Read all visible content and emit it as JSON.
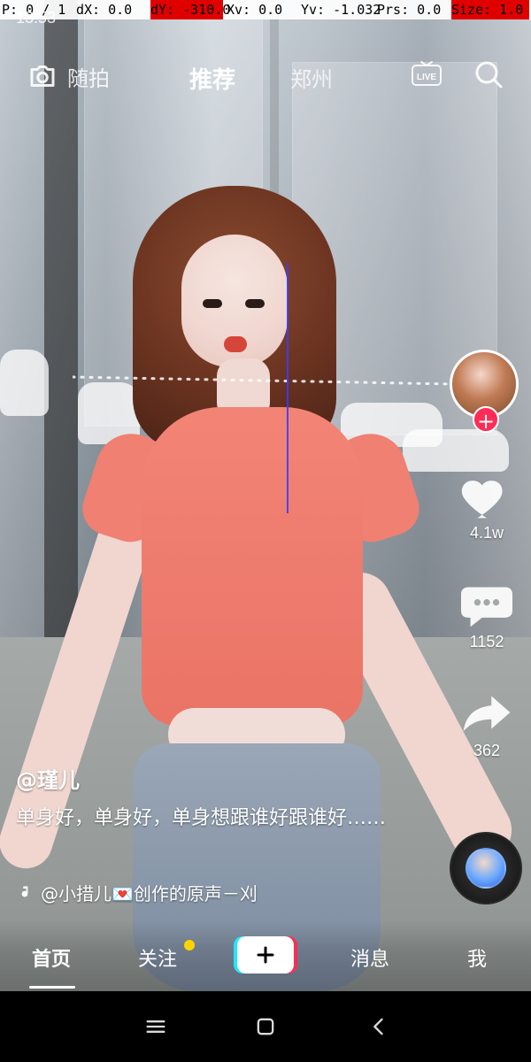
{
  "debug": {
    "p": "P: 0 / 1",
    "dx": "dX: 0.0",
    "dy": "dY: -310.0",
    "xv": "Xv: 0.0",
    "yv": "Yv: -1.032",
    "prs": "Prs: 0.0",
    "size": "Size: 1.0"
  },
  "status": {
    "time": "13:53"
  },
  "top_nav": {
    "left_label": "随拍",
    "center_label": "推荐",
    "right_label": "郑州"
  },
  "right_rail": {
    "likes": "4.1w",
    "comments": "1152",
    "shares": "362"
  },
  "caption": {
    "author": "@瑾儿",
    "text": "单身好，单身好，单身想跟谁好跟谁好……"
  },
  "music": {
    "text": "@小措儿💌创作的原声－刈"
  },
  "bottom_tabs": {
    "home": "首页",
    "follow": "关注",
    "messages": "消息",
    "me": "我"
  },
  "colors": {
    "accent_red": "#ff2c55",
    "accent_cyan": "#22e6ff",
    "notify_yellow": "#ffd400"
  }
}
